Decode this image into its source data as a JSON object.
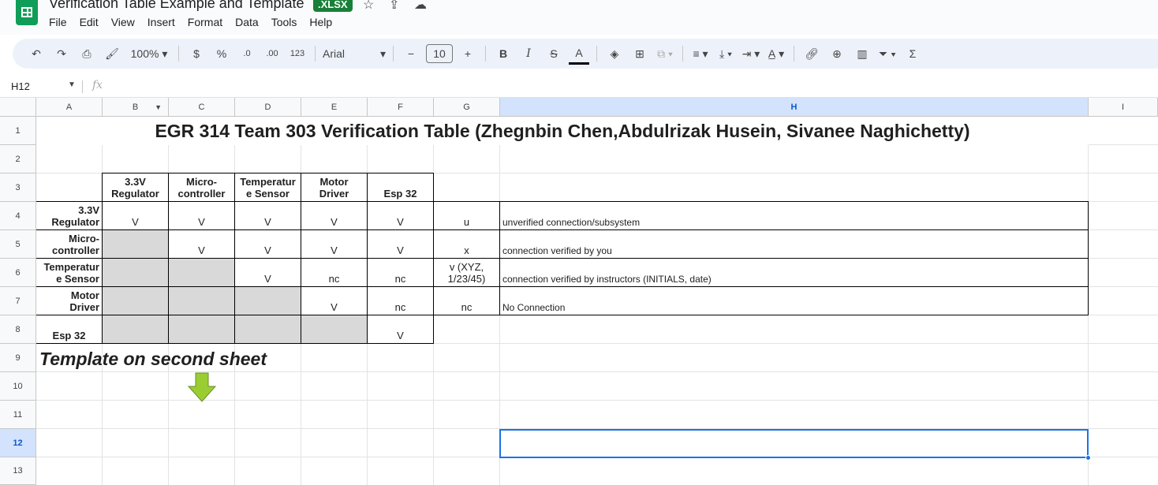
{
  "document": {
    "title": "Verification Table Example and Template",
    "badge": ".XLSX"
  },
  "menu": [
    "File",
    "Edit",
    "View",
    "Insert",
    "Format",
    "Data",
    "Tools",
    "Help"
  ],
  "toolbar": {
    "zoom": "100%",
    "currency": "$",
    "percent": "%",
    "dec_decrease": ".0",
    "dec_increase": ".00",
    "number_format": "123",
    "font": "Arial",
    "font_size": "10",
    "minus": "−",
    "plus": "+",
    "bold": "B",
    "italic": "I",
    "strike": "S",
    "text_color": "A",
    "sigma": "Σ"
  },
  "formula_bar": {
    "name_box": "H12",
    "fx": "fx"
  },
  "columns": [
    "A",
    "B",
    "C",
    "D",
    "E",
    "F",
    "G",
    "H",
    "I"
  ],
  "rows": [
    "1",
    "2",
    "3",
    "4",
    "5",
    "6",
    "7",
    "8",
    "9",
    "10",
    "11",
    "12",
    "13"
  ],
  "sheet": {
    "title": "EGR 314 Team 303 Verification Table (Zhegnbin Chen,Abdulrizak Husein, Sivanee Naghichetty)",
    "col_headers": [
      "3.3V\nRegulator",
      "Micro-\ncontroller",
      "Temperatur\ne Sensor",
      "Motor\nDriver",
      "Esp 32"
    ],
    "row_headers": [
      "3.3V\nRegulator",
      "Micro-\ncontroller",
      "Temperatur\ne Sensor",
      "Motor\nDriver",
      "Esp 32"
    ],
    "matrix": [
      [
        "V",
        "V",
        "V",
        "V",
        "V"
      ],
      [
        "",
        "V",
        "V",
        "V",
        "V"
      ],
      [
        "",
        "",
        "V",
        "nc",
        "nc"
      ],
      [
        "",
        "",
        "",
        "V",
        "nc"
      ],
      [
        "",
        "",
        "",
        "",
        "V"
      ]
    ],
    "legend": [
      {
        "symbol": "u",
        "meaning": "unverified connection/subsystem"
      },
      {
        "symbol": "x",
        "meaning": "connection verified by you"
      },
      {
        "symbol": "v (XYZ,\n1/23/45)",
        "meaning": "connection verified by instructors (INITIALS, date)"
      },
      {
        "symbol": "nc",
        "meaning": "No Connection"
      }
    ],
    "template_note": "Template on second sheet"
  },
  "colors": {
    "accent": "#1a73e8",
    "gray_fill": "#d9d9d9",
    "xlsx_badge": "#188038",
    "arrow": "#9acd32"
  }
}
